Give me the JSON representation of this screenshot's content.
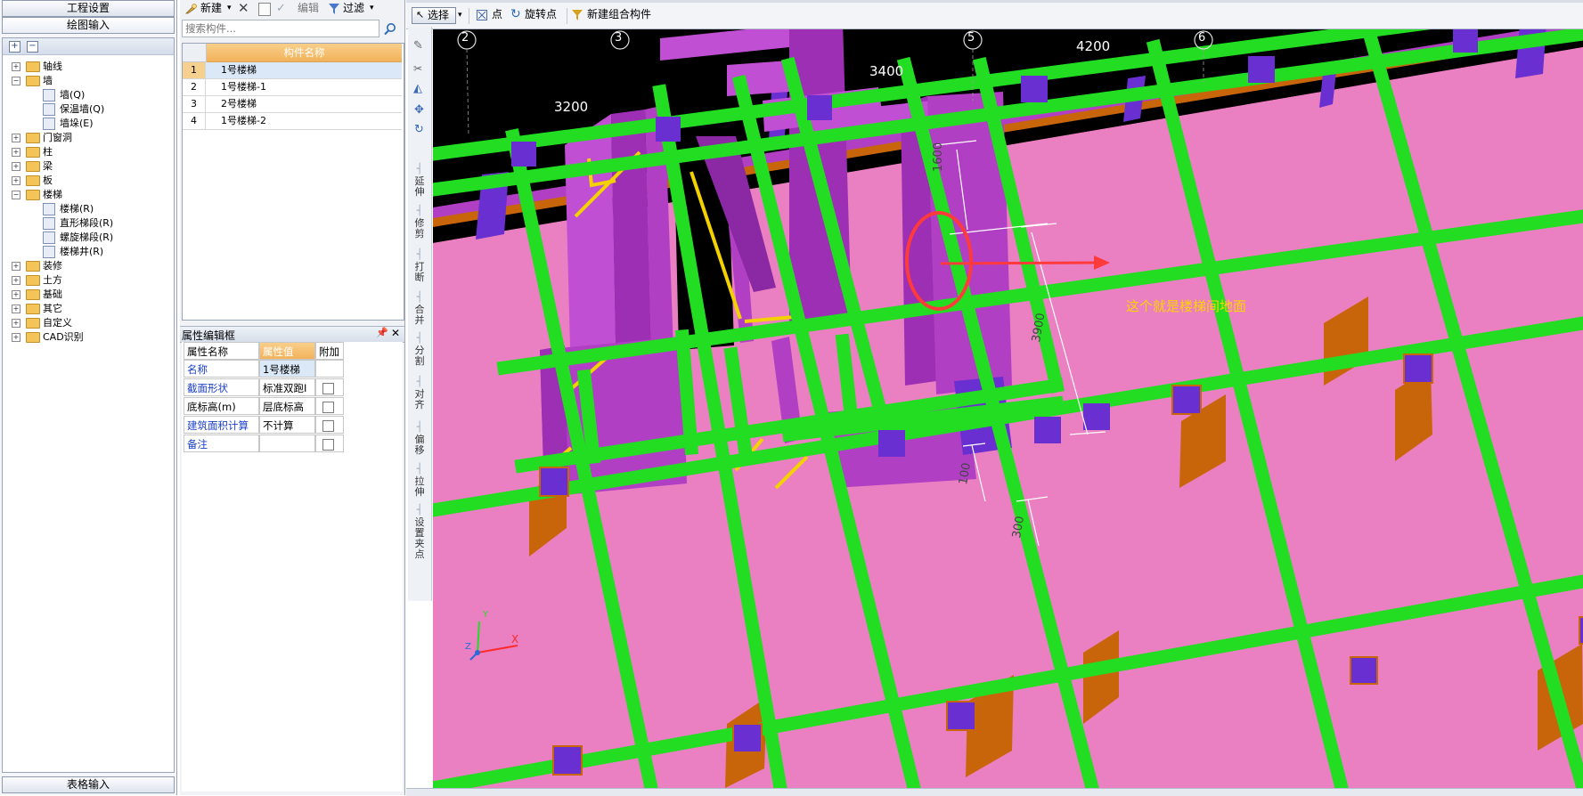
{
  "left_nav": {
    "top_buttons": [
      "工程设置",
      "绘图输入"
    ],
    "bottom_button": "表格输入",
    "tree_tools": [
      "+",
      "−"
    ],
    "tree": [
      {
        "label": "轴线",
        "level": 0,
        "expander": "+"
      },
      {
        "label": "墙",
        "level": 0,
        "expander": "−"
      },
      {
        "label": "墙(Q)",
        "level": 1
      },
      {
        "label": "保温墙(Q)",
        "level": 1
      },
      {
        "label": "墙垛(E)",
        "level": 1
      },
      {
        "label": "门窗洞",
        "level": 0,
        "expander": "+"
      },
      {
        "label": "柱",
        "level": 0,
        "expander": "+"
      },
      {
        "label": "梁",
        "level": 0,
        "expander": "+"
      },
      {
        "label": "板",
        "level": 0,
        "expander": "+"
      },
      {
        "label": "楼梯",
        "level": 0,
        "expander": "−"
      },
      {
        "label": "楼梯(R)",
        "level": 1
      },
      {
        "label": "直形梯段(R)",
        "level": 1
      },
      {
        "label": "螺旋梯段(R)",
        "level": 1
      },
      {
        "label": "楼梯井(R)",
        "level": 1
      },
      {
        "label": "装修",
        "level": 0,
        "expander": "+"
      },
      {
        "label": "土方",
        "level": 0,
        "expander": "+"
      },
      {
        "label": "基础",
        "level": 0,
        "expander": "+"
      },
      {
        "label": "其它",
        "level": 0,
        "expander": "+"
      },
      {
        "label": "自定义",
        "level": 0,
        "expander": "+"
      },
      {
        "label": "CAD识别",
        "level": 0,
        "expander": "+"
      }
    ]
  },
  "component_panel": {
    "toolbar": {
      "new_label": "新建",
      "delete_icon": "close-icon",
      "edit_label": "编辑",
      "filter_label": "过滤"
    },
    "search_placeholder": "搜索构件...",
    "column_header": "构件名称",
    "rows": [
      {
        "num": "1",
        "name": "1号楼梯",
        "selected": true
      },
      {
        "num": "2",
        "name": "1号楼梯-1",
        "selected": false
      },
      {
        "num": "3",
        "name": "2号楼梯",
        "selected": false
      },
      {
        "num": "4",
        "name": "1号楼梯-2",
        "selected": false
      }
    ]
  },
  "properties": {
    "title": "属性编辑框",
    "headers": [
      "属性名称",
      "属性值",
      "附加"
    ],
    "rows": [
      {
        "name": "名称",
        "value": "1号楼梯",
        "has_check": false,
        "blue": true
      },
      {
        "name": "截面形状",
        "value": "标准双跑I",
        "has_check": true,
        "blue": true
      },
      {
        "name": "底标高(m)",
        "value": "层底标高",
        "has_check": true,
        "blue": false
      },
      {
        "name": "建筑面积计算",
        "value": "不计算",
        "has_check": true,
        "blue": true
      },
      {
        "name": "备注",
        "value": "",
        "has_check": true,
        "blue": true
      }
    ]
  },
  "draw_toolbar": {
    "select": "选择",
    "point": "点",
    "rotate_point": "旋转点",
    "new_combo": "新建组合构件"
  },
  "vertical_tools": [
    "延伸",
    "修剪",
    "打断",
    "合并",
    "分割",
    "对齐",
    "偏移",
    "拉伸",
    "设置夹点"
  ],
  "viewport": {
    "axis_numbers": [
      "2",
      "3",
      "5",
      "6"
    ],
    "span_labels": [
      "3200",
      "3400",
      "4200"
    ],
    "dims": [
      "1600",
      "3900",
      "100",
      "300"
    ],
    "annotation": "这个就是楼梯间地面",
    "axes_glyph": {
      "x": "X",
      "y": "Y",
      "z": "Z"
    },
    "colors": {
      "floor": "#ea7fc1",
      "beam": "#22dd22",
      "wall": "#b13fc4",
      "column": "#6a2fd0",
      "footing": "#c8650a",
      "annotation": "#ff3a3a",
      "annotation_text": "#ffd400"
    }
  }
}
